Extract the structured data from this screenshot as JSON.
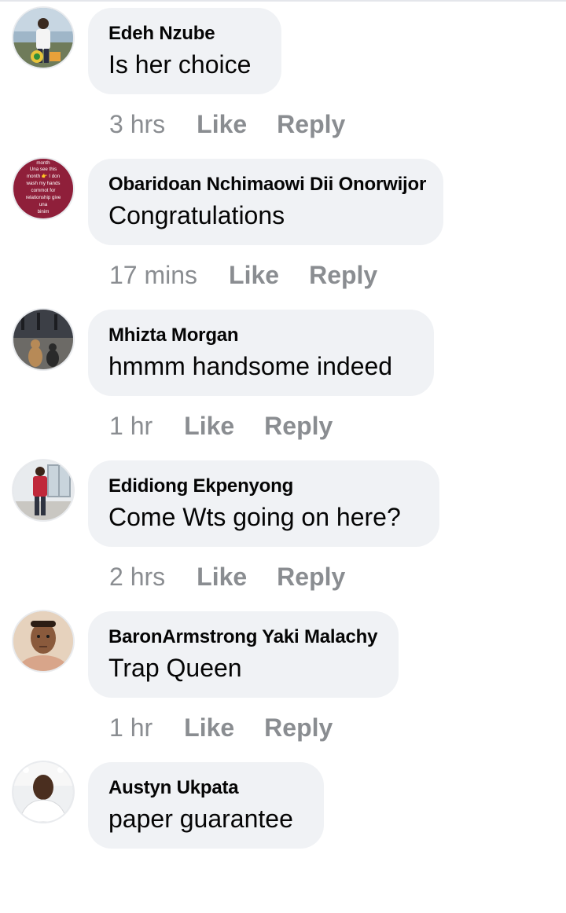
{
  "comments": [
    {
      "author": "Edeh Nzube",
      "text": "Is her choice",
      "time": "3 hrs",
      "like_label": "Like",
      "reply_label": "Reply",
      "avatar": "avatar-person-outdoor"
    },
    {
      "author": "Obaridoan Nchimaowi Dii Onorwijor",
      "text": "Congratulations",
      "time": "17 mins",
      "like_label": "Like",
      "reply_label": "Reply",
      "avatar": "avatar-text-graphic",
      "avatar_text": [
        "month",
        "Una see this",
        "month 👉 I don",
        "wash my hands",
        "commot for",
        "relationship give",
        "una",
        "binim"
      ]
    },
    {
      "author": "Mhizta Morgan",
      "text": "hmmm handsome indeed",
      "time": "1 hr",
      "like_label": "Like",
      "reply_label": "Reply",
      "avatar": "avatar-cats"
    },
    {
      "author": "Edidiong Ekpenyong",
      "text": "Come Wts going on here?",
      "time": "2 hrs",
      "like_label": "Like",
      "reply_label": "Reply",
      "avatar": "avatar-person-red"
    },
    {
      "author": "BaronArmstrong Yaki Malachy",
      "text": "Trap Queen",
      "time": "1 hr",
      "like_label": "Like",
      "reply_label": "Reply",
      "avatar": "avatar-face"
    },
    {
      "author": "Austyn Ukpata",
      "text": "paper guarantee",
      "avatar": "avatar-person-white"
    }
  ],
  "colors": {
    "bubble": "#f0f2f5",
    "meta": "#8a8d91",
    "text": "#050505"
  }
}
